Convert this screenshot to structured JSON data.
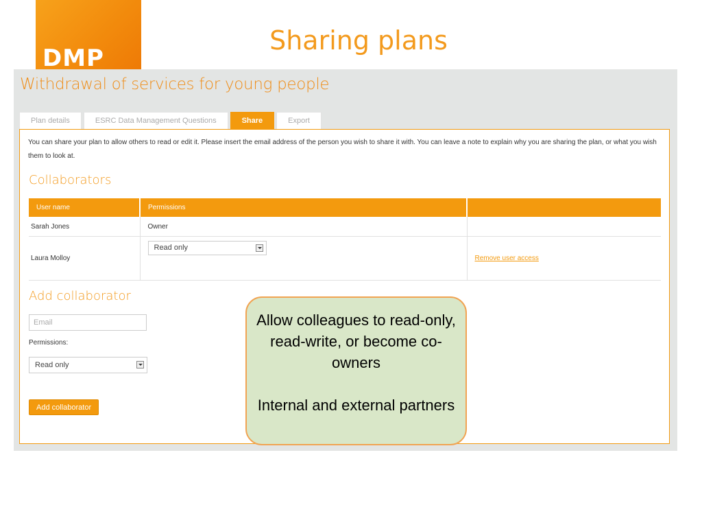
{
  "slide": {
    "title": "Sharing plans",
    "logo_text": "DMP"
  },
  "plan": {
    "title": "Withdrawal of services for young people"
  },
  "tabs": [
    {
      "label": "Plan details",
      "active": false
    },
    {
      "label": "ESRC Data Management Questions",
      "active": false
    },
    {
      "label": "Share",
      "active": true
    },
    {
      "label": "Export",
      "active": false
    }
  ],
  "share": {
    "intro": "You can share your plan to allow others to read or edit it. Please insert the email address of the person you wish to share it with. You can leave a note to explain why you are sharing the plan, or what you wish them to look at.",
    "collaborators_heading": "Collaborators",
    "table": {
      "headers": [
        "User name",
        "Permissions",
        ""
      ],
      "rows": [
        {
          "user": "Sarah Jones",
          "permission": "Owner"
        },
        {
          "user": "Laura Molloy",
          "permission": "Read only",
          "action": "Remove user access"
        }
      ]
    },
    "add_heading": "Add collaborator",
    "email_placeholder": "Email",
    "permissions_label": "Permissions:",
    "permission_select_value": "Read only",
    "add_button": "Add collaborator"
  },
  "callout": {
    "line1": "Allow colleagues to read-only, read-write, or become co-owners",
    "line2": "Internal and external partners"
  },
  "colors": {
    "accent": "#f39a0e",
    "callout_bg": "#d9e7c8",
    "callout_border": "#f1a352"
  }
}
